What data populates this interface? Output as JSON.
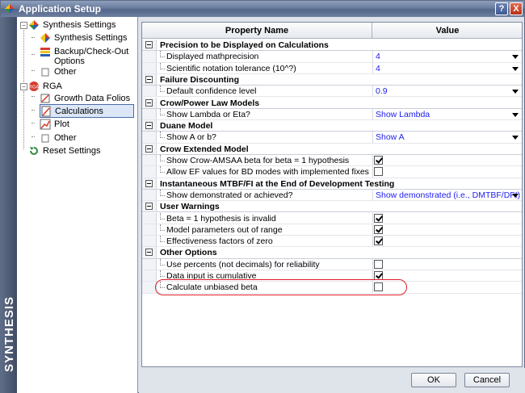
{
  "window": {
    "title": "Application Setup",
    "help_label": "?",
    "close_label": "X"
  },
  "brand": {
    "text": "SYNTHESIS"
  },
  "tree": [
    {
      "label": "Synthesis Settings",
      "icon": "synthesis-icon"
    },
    {
      "label": "Synthesis Settings",
      "icon": "synthesis-settings-icon"
    },
    {
      "label": "Backup/Check-Out Options",
      "icon": "backup-icon"
    },
    {
      "label": "Other",
      "icon": "other-icon"
    },
    {
      "label": "RGA",
      "icon": "rga-icon"
    },
    {
      "label": "Growth Data Folios",
      "icon": "folio-icon"
    },
    {
      "label": "Calculations",
      "icon": "calculations-icon"
    },
    {
      "label": "Plot",
      "icon": "plot-icon"
    },
    {
      "label": "Other",
      "icon": "other-icon"
    },
    {
      "label": "Reset Settings",
      "icon": "reset-icon"
    }
  ],
  "grid": {
    "col_property": "Property Name",
    "col_value": "Value",
    "categories": [
      {
        "name": "Precision to be Displayed on Calculations",
        "props": [
          {
            "name": "Displayed mathprecision",
            "value": "4",
            "type": "dropdown"
          },
          {
            "name": "Scientific notation tolerance (10^?)",
            "value": "4",
            "type": "dropdown"
          }
        ]
      },
      {
        "name": "Failure Discounting",
        "props": [
          {
            "name": "Default confidence level",
            "value": "0.9",
            "type": "dropdown"
          }
        ]
      },
      {
        "name": "Crow/Power Law Models",
        "props": [
          {
            "name": "Show Lambda or Eta?",
            "value": "Show Lambda",
            "type": "dropdown"
          }
        ]
      },
      {
        "name": "Duane Model",
        "props": [
          {
            "name": "Show A or b?",
            "value": "Show A",
            "type": "dropdown"
          }
        ]
      },
      {
        "name": "Crow Extended Model",
        "props": [
          {
            "name": "Show Crow-AMSAA beta for beta = 1 hypothesis",
            "checked": true,
            "type": "checkbox"
          },
          {
            "name": "Allow EF values for BD modes with implemented fixes",
            "checked": false,
            "type": "checkbox"
          }
        ]
      },
      {
        "name": "Instantaneous MTBF/FI at the End of Development Testing",
        "props": [
          {
            "name": "Show demonstrated or achieved?",
            "value": "Show demonstrated (i.e., DMTBF/DFI)",
            "type": "dropdown"
          }
        ]
      },
      {
        "name": "User Warnings",
        "props": [
          {
            "name": "Beta = 1 hypothesis is invalid",
            "checked": true,
            "type": "checkbox"
          },
          {
            "name": "Model parameters out of range",
            "checked": true,
            "type": "checkbox"
          },
          {
            "name": "Effectiveness factors of zero",
            "checked": true,
            "type": "checkbox"
          }
        ]
      },
      {
        "name": "Other Options",
        "props": [
          {
            "name": "Use percents (not decimals) for reliability",
            "checked": false,
            "type": "checkbox"
          },
          {
            "name": "Data input is cumulative",
            "checked": true,
            "type": "checkbox"
          },
          {
            "name": "Calculate unbiased beta",
            "checked": false,
            "type": "checkbox"
          }
        ]
      }
    ]
  },
  "buttons": {
    "ok": "OK",
    "cancel": "Cancel"
  },
  "colors": {
    "value_text": "#1d1df0",
    "highlight": "#e0202a",
    "selection": "#dbe6f7"
  }
}
